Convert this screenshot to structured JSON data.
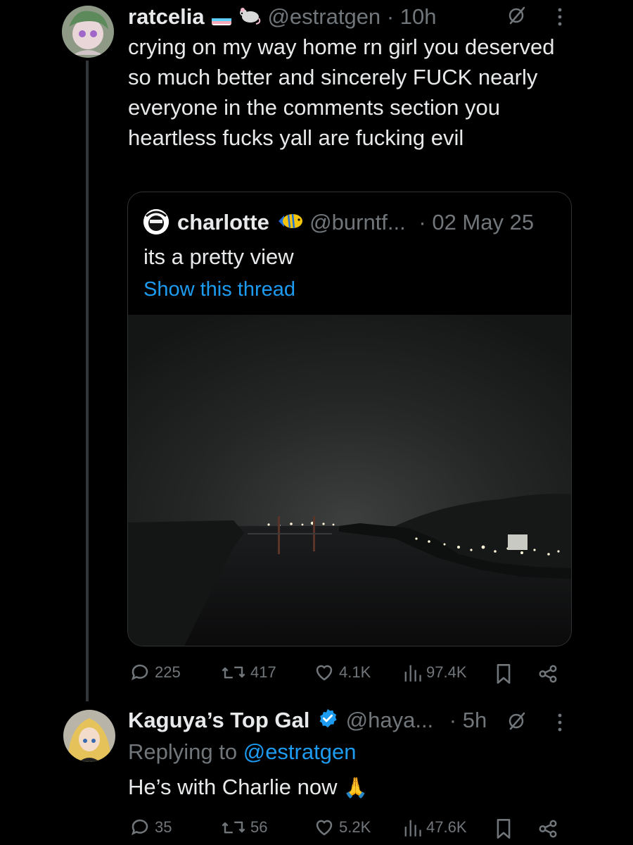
{
  "colors": {
    "background": "#000000",
    "text": "#e7e9ea",
    "muted": "#71767b",
    "link": "#1d9bf0",
    "verified": "#1d9bf0"
  },
  "tweet1": {
    "display_name": "ratcelia",
    "handle": "@estratgen",
    "separator": "·",
    "time": "10h",
    "text": "crying on my way home rn girl you deserved so much better and sincerely FUCK nearly everyone in the comments section you heartless fucks yall are fucking evil",
    "badges": [
      "transgender-flag-icon",
      "rat-icon"
    ],
    "quote": {
      "display_name": "charlotte",
      "handle": "@burntf...",
      "date": "· 02 May 25",
      "text": "its a pretty view",
      "show_thread": "Show this thread",
      "badge": "tropical-fish-icon"
    },
    "stats": {
      "replies": "225",
      "reposts": "417",
      "likes": "4.1K",
      "views": "97.4K"
    }
  },
  "tweet2": {
    "display_name": "Kaguya’s Top Gal",
    "handle": "@haya...",
    "separator": "·",
    "time": "5h",
    "replying_prefix": "Replying to",
    "replying_handle": "@estratgen",
    "text": "He’s with Charlie now",
    "emoji": "🙏",
    "stats": {
      "replies": "35",
      "reposts": "56",
      "likes": "5.2K",
      "views": "47.6K"
    }
  }
}
